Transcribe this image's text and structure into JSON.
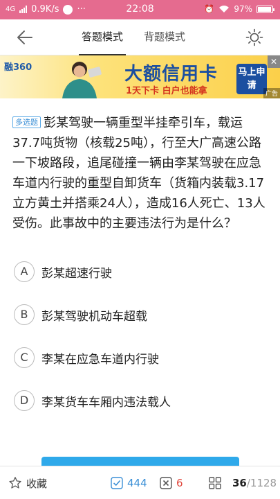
{
  "status_bar": {
    "network": "4G",
    "speed": "0.9K/s",
    "time": "22:08",
    "battery": "97%"
  },
  "nav": {
    "tabs": [
      {
        "label": "答题模式",
        "active": true
      },
      {
        "label": "背题模式",
        "active": false
      }
    ]
  },
  "ad": {
    "logo": "融360",
    "title": "大额信用卡",
    "subtitle": "1天下卡  白户也能拿",
    "cta": "马上申请",
    "tag": "广告",
    "close": "✕"
  },
  "question": {
    "type": "多选题",
    "text": "彭某驾驶一辆重型半挂牵引车，载运37.7吨货物（核载25吨），行至大广高速公路一下坡路段，追尾碰撞一辆由李某驾驶在应急车道内行驶的重型自卸货车（货箱内装载3.17立方黄土并搭乘24人），造成16人死亡、13人受伤。此事故中的主要违法行为是什么？"
  },
  "options": [
    {
      "letter": "A",
      "text": "彭某超速行驶"
    },
    {
      "letter": "B",
      "text": "彭某驾驶机动车超载"
    },
    {
      "letter": "C",
      "text": "李某在应急车道内行驶"
    },
    {
      "letter": "D",
      "text": "李某货车车厢内违法载人"
    }
  ],
  "bottom_bar": {
    "favorite_label": "收藏",
    "correct_count": "444",
    "wrong_count": "6",
    "current": "36",
    "total": "/1128"
  },
  "colors": {
    "status_bar": "#e56b8f",
    "accent_blue": "#3a8fd6",
    "wrong_red": "#e0463c"
  }
}
